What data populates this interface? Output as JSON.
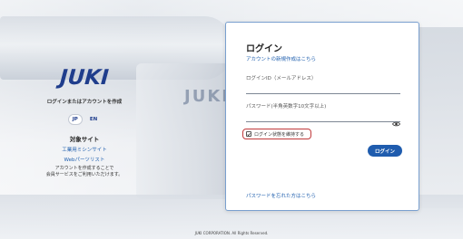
{
  "brand": {
    "logo_text": "JUKI",
    "background_logo_text": "JUKI",
    "tagline": "ログインまたはアカウントを作成",
    "color": "#1f3d8c"
  },
  "language": {
    "options": [
      "JP",
      "EN"
    ],
    "selected": "JP"
  },
  "target_sites": {
    "title": "対象サイト",
    "links": [
      "工業用ミシンサイト",
      "Webパーツリスト"
    ],
    "note_line1": "アカウントを作成することで",
    "note_line2": "会員サービスをご利用いただけます。"
  },
  "login_form": {
    "title": "ログイン",
    "create_account_link": "アカウントの新規作成はこちら",
    "login_id_label": "ログインID（メールアドレス）",
    "login_id_value": "",
    "password_label": "パスワード(半角英数字10文字以上)",
    "password_value": "",
    "password_toggle_icon": "eye-icon",
    "remember_label": "ログイン状態を維持する",
    "remember_checked": true,
    "submit_label": "ログイン",
    "forgot_link": "パスワードを忘れた方はこちら",
    "accent_color": "#1f5cae",
    "highlight_color": "#c0393b"
  },
  "footer": {
    "copyright": "JUKI CORPORATION. All Rights Reserved."
  }
}
